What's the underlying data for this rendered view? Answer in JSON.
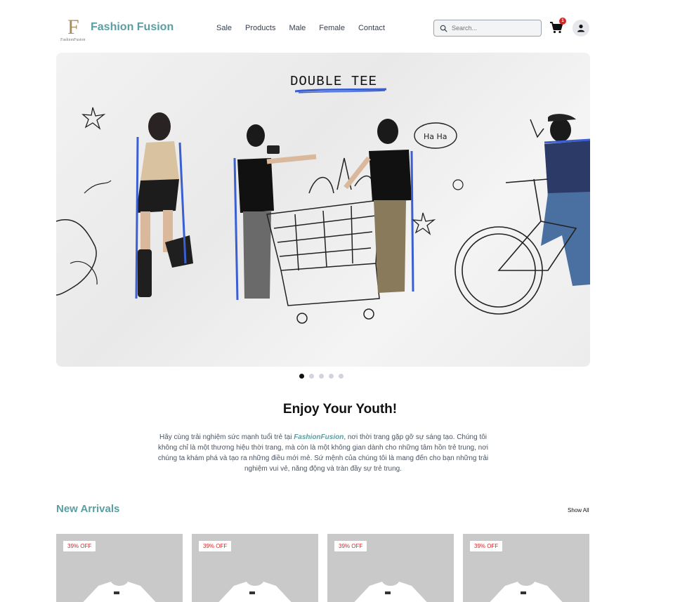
{
  "header": {
    "logo_letter": "F",
    "logo_small_text": "FashionFusion",
    "brand": "Fashion Fusion",
    "nav": [
      "Sale",
      "Products",
      "Male",
      "Female",
      "Contact"
    ],
    "search_placeholder": "Search...",
    "cart_count": "1",
    "icons": {
      "search": "search-icon",
      "cart": "cart-icon",
      "user": "user-icon"
    }
  },
  "banner": {
    "title": "DOUBLE TEE",
    "art_text": "Ha Ha",
    "slides_total": 5,
    "active_slide": 1
  },
  "intro": {
    "title": "Enjoy Your Youth!",
    "text_before": "Hãy cùng trải nghiệm sức mạnh tuổi trẻ tại ",
    "brand_inline": "FashionFusion",
    "text_after": ", nơi thời trang gặp gỡ sự sáng tạo. Chúng tôi không chỉ là một thương hiệu thời trang, mà còn là một không gian dành cho những tâm hồn trẻ trung, nơi chúng ta khám phá và tạo ra những điều mới mẻ. Sứ mệnh của chúng tôi là mang đến cho bạn những trải nghiệm vui vẻ, năng động và tràn đầy sự trẻ trung."
  },
  "arrivals": {
    "title": "New Arrivals",
    "show_all": "Show All",
    "products": [
      {
        "discount": "39% OFF"
      },
      {
        "discount": "39% OFF"
      },
      {
        "discount": "39% OFF"
      },
      {
        "discount": "39% OFF"
      }
    ]
  },
  "colors": {
    "brand": "#5b9ea2",
    "badge": "#dc2626",
    "card_bg": "#c9c9c9",
    "accent_blue": "#3b5fd0"
  }
}
